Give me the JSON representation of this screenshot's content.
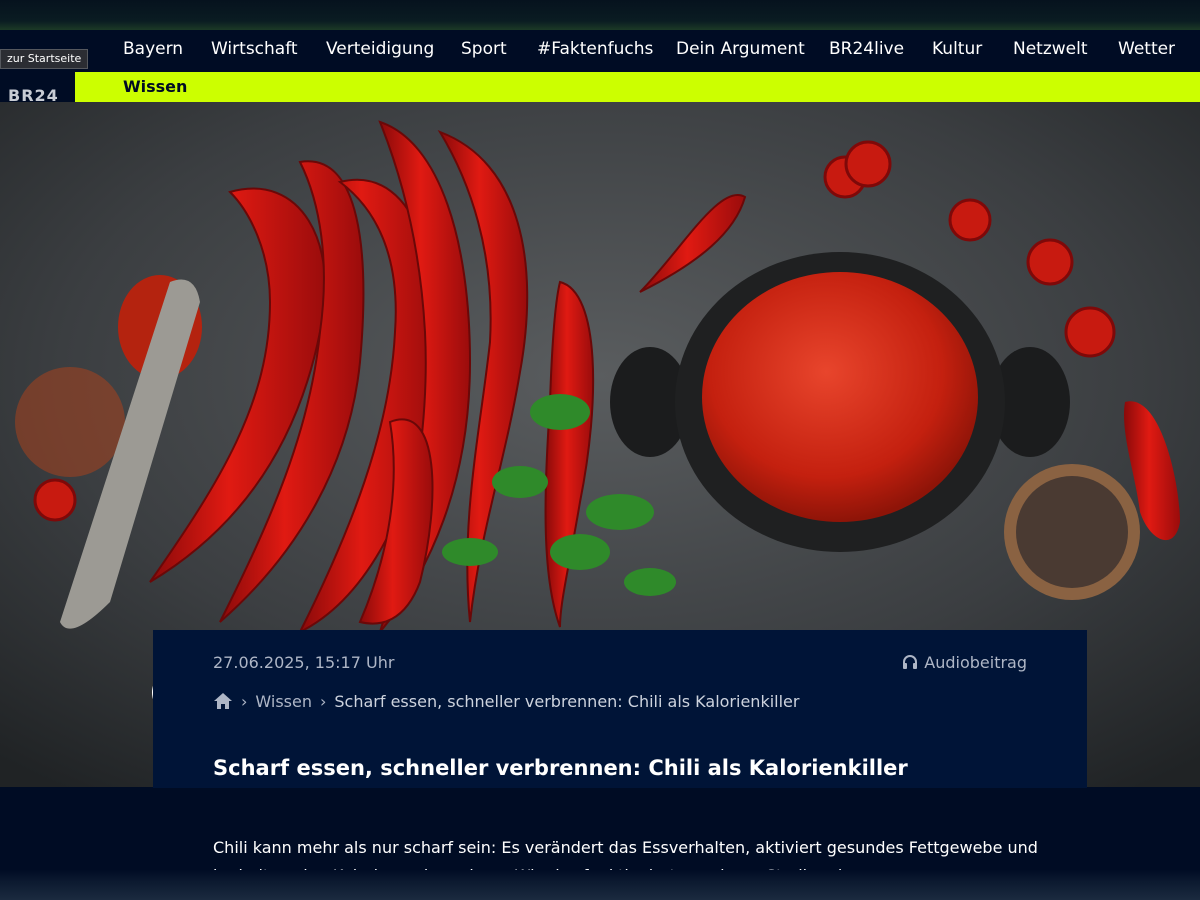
{
  "header": {
    "logo_text": "BR24",
    "tooltip": "zur Startseite",
    "nav": [
      "Bayern",
      "Wirtschaft",
      "Verteidigung",
      "Sport",
      "#Faktenfuchs",
      "Dein Argument",
      "BR24live",
      "Kultur",
      "Netzwelt",
      "Wetter"
    ],
    "subnav_active": "Wissen"
  },
  "hero": {
    "image_icon": "play-icon"
  },
  "article": {
    "date": "27.06.2025, 15:17 Uhr",
    "audio_label": "Audiobeitrag",
    "audio_icon": "headphones-icon",
    "breadcrumb": [
      "Wissen",
      "Scharf essen, schneller verbrennen: Chili als Kalorienkiller"
    ],
    "breadcrumb_home_icon": "home-icon",
    "title": "Scharf essen, schneller verbrennen: Chili als Kalorienkiller",
    "teaser": "Chili kann mehr als nur scharf sein: Es verändert das Essverhalten, aktiviert gesundes Fettgewebe und kurbelt so den Kalorienverbrauch an. Wie das funktioniert – und was Studien dazu sagen."
  },
  "colors": {
    "navy": "#000c24",
    "card": "#001437",
    "accent": "#ccff00"
  }
}
